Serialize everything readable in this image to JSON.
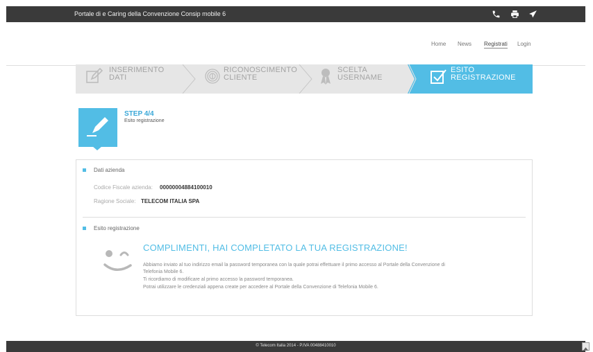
{
  "header": {
    "title": "Portale di e Caring della Convenzione Consip mobile 6",
    "icons": [
      "phone-icon",
      "print-icon",
      "send-icon"
    ]
  },
  "nav": {
    "items": [
      "Home",
      "News",
      "Registrati",
      "Login"
    ],
    "active": "Registrati"
  },
  "steps": [
    {
      "line1": "INSERIMENTO",
      "line2": "DATI",
      "icon": "edit-form-icon"
    },
    {
      "line1": "RICONOSCIMENTO",
      "line2": "CLIENTE",
      "icon": "fingerprint-icon"
    },
    {
      "line1": "SCELTA",
      "line2": "USERNAME",
      "icon": "award-icon"
    },
    {
      "line1": "ESITO",
      "line2": "REGISTRAZIONE",
      "icon": "checkbox-icon",
      "active": true
    }
  ],
  "step_info": {
    "title": "STEP 4/4",
    "subtitle": "Esito registrazione"
  },
  "company": {
    "section_label": "Dati azienda",
    "fiscal_code_label": "Codice Fiscale azienda:",
    "fiscal_code_value": "00000004884100010",
    "company_name_label": "Ragione Sociale:",
    "company_name_value": "TELECOM ITALIA SPA"
  },
  "result": {
    "section_label": "Esito registrazione",
    "title": "COMPLIMENTI, HAI COMPLETATO LA TUA REGISTRAZIONE!",
    "line1": "Abbiamo inviato al tuo indirizzo email la password temporanea con la quale potrai effettuare il primo accesso al Portale della Convenzione di",
    "line2": "Telefonia Mobile 6.",
    "line3": "Ti ricordiamo di modificare al primo accesso la password temporanea.",
    "line4": "Potrai utilizzare le credenziali appena create per accedere al Portale della Convenzione di Telefonia Mobile 6."
  },
  "footer": {
    "copyright": "© Telecom Italia 2014 - P.IVA 00488410010"
  },
  "colors": {
    "accent": "#52bde5",
    "dark_bar": "#3a3a3a"
  }
}
